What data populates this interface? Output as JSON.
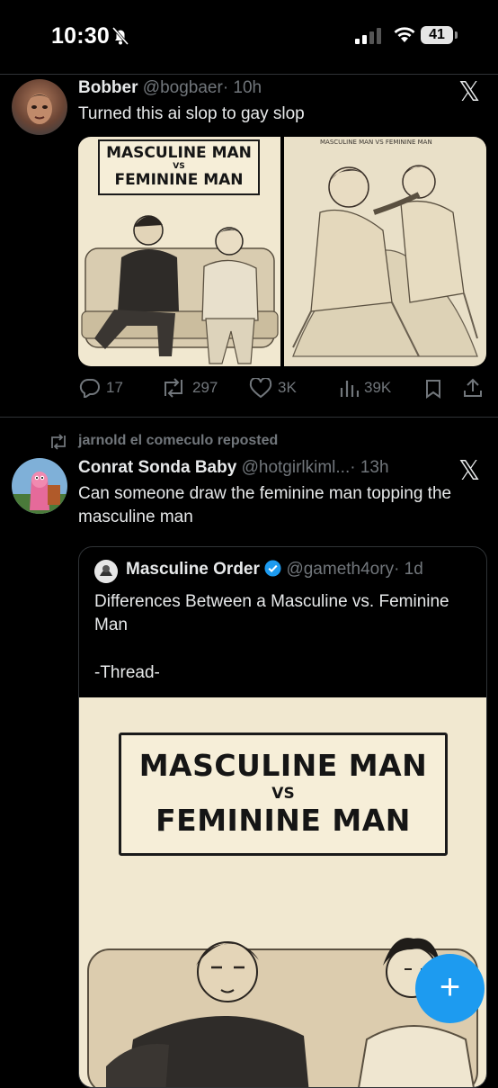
{
  "status_bar": {
    "time": "10:30",
    "battery": "41"
  },
  "tweet1": {
    "author_name": "Bobber",
    "handle": "@bogbaer",
    "time": "· 10h",
    "text": "Turned this ai slop to gay slop",
    "image_left": {
      "line1": "MASCULINE MAN",
      "vs": "VS",
      "line2": "FEMININE MAN"
    },
    "image_right": {
      "caption": "MASCULINE MAN VS FEMININE MAN"
    },
    "stats": {
      "replies": "17",
      "reposts": "297",
      "likes": "3K",
      "views": "39K"
    }
  },
  "tweet2": {
    "repost_label": "jarnold el comeculo reposted",
    "author_name": "Conrat Sonda Baby",
    "handle": "@hotgirlkiml...",
    "time": "· 13h",
    "text": "Can someone draw the feminine man topping the masculine man",
    "quote": {
      "author_name": "Masculine Order",
      "handle": "@gameth4ory",
      "time": "· 1d",
      "text": "Differences Between a Masculine vs. Feminine Man",
      "thread": "-Thread-",
      "image": {
        "line1": "MASCULINE MAN",
        "vs": "VS",
        "line2": "FEMININE MAN"
      }
    }
  },
  "icons": [
    "bell-slash-icon",
    "signal-icon",
    "wifi-icon",
    "battery-icon",
    "x-logo-icon",
    "reply-icon",
    "repost-icon",
    "like-icon",
    "views-icon",
    "bookmark-icon",
    "share-icon",
    "verified-badge-icon",
    "compose-icon"
  ]
}
